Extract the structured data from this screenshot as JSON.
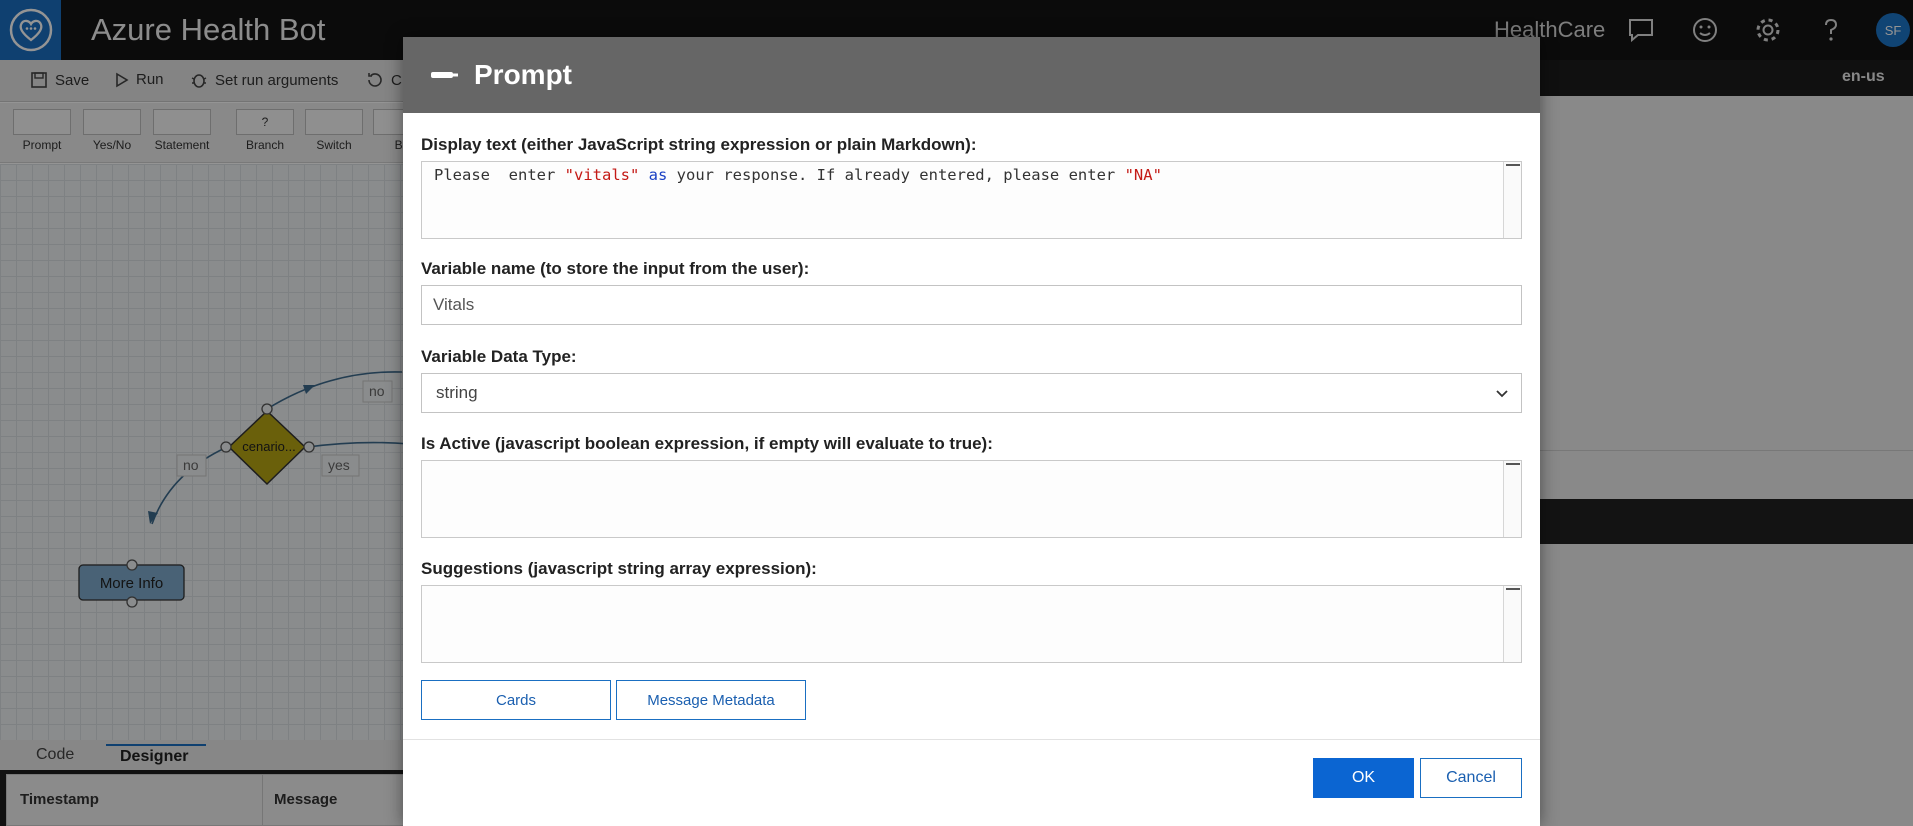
{
  "app": {
    "title": "Azure Health Bot",
    "org": "HealthCare",
    "avatar_initials": "SF",
    "brand_color": "#1a6fc2"
  },
  "toolbar": {
    "save_label": "Save",
    "run_label": "Run",
    "run_args_label": "Set run arguments",
    "truncated_label": "C",
    "locale": "en-us"
  },
  "palette": [
    {
      "label": "Prompt",
      "icon": "prompt-icon"
    },
    {
      "label": "Yes/No",
      "icon": "yes-no-icon"
    },
    {
      "label": "Statement",
      "icon": "statement-icon"
    },
    {
      "label": "Branch",
      "icon": "branch-icon",
      "glyph": "?"
    },
    {
      "label": "Switch",
      "icon": "switch-icon"
    },
    {
      "label": "Be",
      "icon": "truncated-icon"
    }
  ],
  "canvas": {
    "edge_labels": [
      "no",
      "no",
      "yes"
    ],
    "decision_node_label": "cenario...",
    "info_node_label": "More Info"
  },
  "bottom_tabs": [
    "Code",
    "Designer"
  ],
  "log_columns": [
    "Timestamp",
    "Message"
  ],
  "modal": {
    "title": "Prompt",
    "display_text_label": "Display text (either JavaScript string expression or plain Markdown):",
    "display_text_code": {
      "t1": "Please  enter ",
      "s1": "\"vitals\"",
      "t2": " ",
      "kw": "as",
      "t3": " your response. If already entered, please enter ",
      "s2": "\"NA\""
    },
    "variable_name_label": "Variable name (to store the input from the user):",
    "variable_name_value": "Vitals",
    "data_type_label": "Variable Data Type:",
    "data_type_value": "string",
    "is_active_label": "Is Active (javascript boolean expression, if empty will evaluate to true):",
    "suggestions_label": "Suggestions (javascript string array expression):",
    "cards_button": "Cards",
    "metadata_button": "Message Metadata",
    "ok_button": "OK",
    "cancel_button": "Cancel",
    "string_color": "#c41a16",
    "keyword_color": "#1a40c4"
  }
}
